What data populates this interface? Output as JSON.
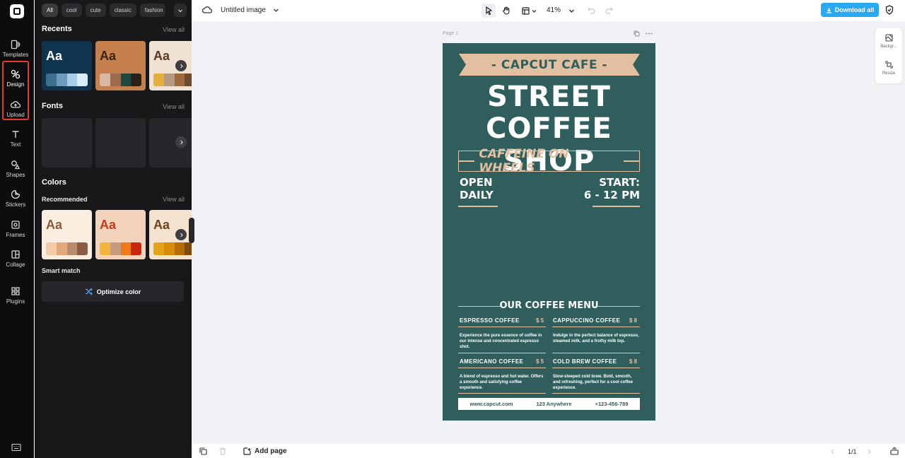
{
  "rail": {
    "items": [
      {
        "label": "Templates",
        "icon": "templates-icon"
      },
      {
        "label": "Design",
        "icon": "design-icon"
      },
      {
        "label": "Upload",
        "icon": "upload-icon"
      },
      {
        "label": "Text",
        "icon": "text-icon"
      },
      {
        "label": "Shapes",
        "icon": "shapes-icon"
      },
      {
        "label": "Stickers",
        "icon": "stickers-icon"
      },
      {
        "label": "Frames",
        "icon": "frames-icon"
      },
      {
        "label": "Collage",
        "icon": "collage-icon"
      },
      {
        "label": "Plugins",
        "icon": "plugins-icon"
      }
    ],
    "active": "Design"
  },
  "panel": {
    "chips": [
      "All",
      "cool",
      "cute",
      "classic",
      "fashion"
    ],
    "recents": {
      "title": "Recents",
      "view_all": "View all",
      "cards": [
        {
          "aa": "Aa",
          "bg": "#0f3450",
          "text": "#ffffff",
          "swatches": [
            "#3d6f8e",
            "#6d9bbd",
            "#a8cde8",
            "#d9ecf7"
          ]
        },
        {
          "aa": "Aa",
          "bg": "#c6804e",
          "text": "#3a2314",
          "swatches": [
            "#d8b8a2",
            "#9c6a4d",
            "#1f4a42",
            "#2a211c"
          ]
        },
        {
          "aa": "Aa",
          "bg": "#efe2d3",
          "text": "#5a3a22",
          "swatches": [
            "#e6ae3c",
            "#b59a80",
            "#a06a3c",
            "#6f4b2d"
          ]
        }
      ]
    },
    "fonts": {
      "title": "Fonts",
      "view_all": "View all"
    },
    "colors": {
      "title": "Colors",
      "recommended": "Recommended",
      "view_all": "View all",
      "cards": [
        {
          "aa": "Aa",
          "bg": "#fbeee0",
          "text": "#8b5a3c",
          "swatches": [
            "#f4cba5",
            "#e4a97a",
            "#b98a6c",
            "#8a5c44"
          ]
        },
        {
          "aa": "Aa",
          "bg": "#f4d3bd",
          "text": "#c53a1c",
          "swatches": [
            "#f3b53c",
            "#c69a7f",
            "#ef7a1a",
            "#c9270f"
          ]
        },
        {
          "aa": "Aa",
          "bg": "#f6e3cf",
          "text": "#6a4322",
          "swatches": [
            "#e2a317",
            "#d88c0e",
            "#b56d0c",
            "#7f4a0e"
          ]
        }
      ],
      "smart_match": "Smart match",
      "optimize": "Optimize color"
    }
  },
  "topbar": {
    "title": "Untitled image",
    "zoom": "41%",
    "download": "Download all"
  },
  "canvas": {
    "page_label": "Page 1"
  },
  "poster": {
    "ribbon": "- CAPCUT CAFE -",
    "headline1": "STREET",
    "headline2": "COFFEE SHOP",
    "tagline": "CAFFEINE ON WHEELS",
    "open1": "OPEN",
    "open2": "DAILY",
    "start1": "START:",
    "start2": "6 - 12 PM",
    "menu_title": "OUR COFFEE MENU",
    "items": [
      {
        "name": "ESPRESSO COFFEE",
        "price": "$ 5",
        "desc": "Experience the pure essence of coffee in our intense and concentrated espresso shot."
      },
      {
        "name": "CAPPUCCINO COFFEE",
        "price": "$ 8",
        "desc": "Indulge in the perfect balance of espresso, steamed milk, and a frothy milk top."
      },
      {
        "name": "AMERICANO COFFEE",
        "price": "$ 5",
        "desc": "A blend of espresso and hot water. Offers a smooth and satisfying coffee experience."
      },
      {
        "name": "COLD BREW COFFEE",
        "price": "$ 8",
        "desc": "Slow-steeped cold brew. Bold, smooth, and refreshing, perfect for a cool coffee experience."
      }
    ],
    "footer": [
      "www.capcut.com",
      "123 Anywhere",
      "+123-456-789"
    ],
    "colors": {
      "bg": "#2f5e5d",
      "accent": "#e2bfa0"
    }
  },
  "right_panel": {
    "background": "Backgr...",
    "resize": "Resize"
  },
  "bottombar": {
    "add_page": "Add page",
    "pager": "1/1"
  }
}
